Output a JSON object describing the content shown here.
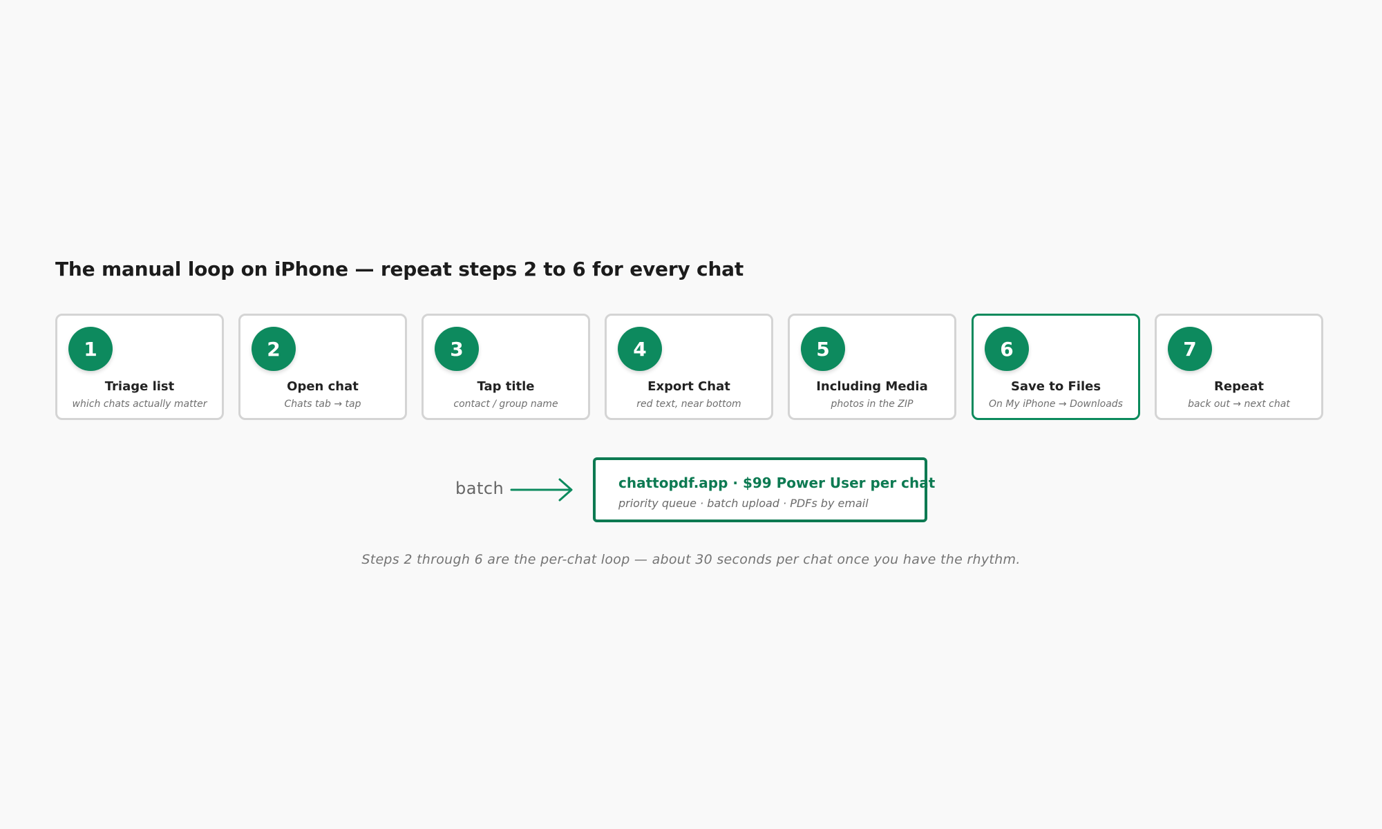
{
  "title": "The manual loop on iPhone — repeat steps 2 to 6 for every chat",
  "steps": [
    {
      "number": "1",
      "title": "Triage list",
      "subtitle": "which chats actually matter"
    },
    {
      "number": "2",
      "title": "Open chat",
      "subtitle": "Chats tab → tap"
    },
    {
      "number": "3",
      "title": "Tap title",
      "subtitle": "contact / group name"
    },
    {
      "number": "4",
      "title": "Export Chat",
      "subtitle": "red text, near bottom"
    },
    {
      "number": "5",
      "title": "Including Media",
      "subtitle": "photos in the ZIP"
    },
    {
      "number": "6",
      "title": "Save to Files",
      "subtitle": "On My iPhone → Downloads"
    },
    {
      "number": "7",
      "title": "Repeat",
      "subtitle": "back out → next chat"
    }
  ],
  "highlighted_step": "6",
  "batch_label": "batch",
  "cta": {
    "title": "chattopdf.app · $99 Power User per chat",
    "subtitle": "priority queue · batch upload · PDFs by email"
  },
  "footnote": "Steps 2 through 6 are the per-chat loop — about 30 seconds per chat once you have the rhythm.",
  "colors": {
    "accent": "#0d8a5e",
    "cta_border": "#0d7a52",
    "card_border": "#d4d4d4",
    "background": "#f9f9f9"
  }
}
